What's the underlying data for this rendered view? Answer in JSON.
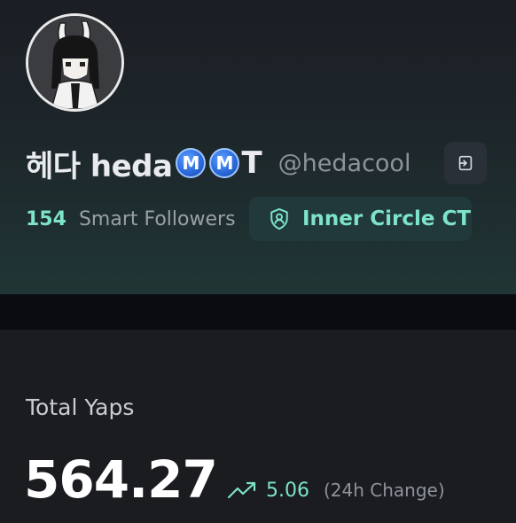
{
  "profile": {
    "display_name": "헤다 heda",
    "badges": [
      "M",
      "M"
    ],
    "name_tail": "T",
    "handle": "@hedacool",
    "smart_followers_count": "154",
    "smart_followers_label": "Smart Followers",
    "inner_circle_label": "Inner Circle CT"
  },
  "yaps": {
    "title": "Total Yaps",
    "total": "564.27",
    "change": "5.06",
    "change_label": "(24h Change)"
  },
  "icons": {
    "logout": "logout-icon",
    "shield": "shield-user-icon",
    "trend": "trending-up-icon"
  },
  "colors": {
    "accent": "#7de3c9",
    "badge_blue": "#2c6bdc"
  }
}
